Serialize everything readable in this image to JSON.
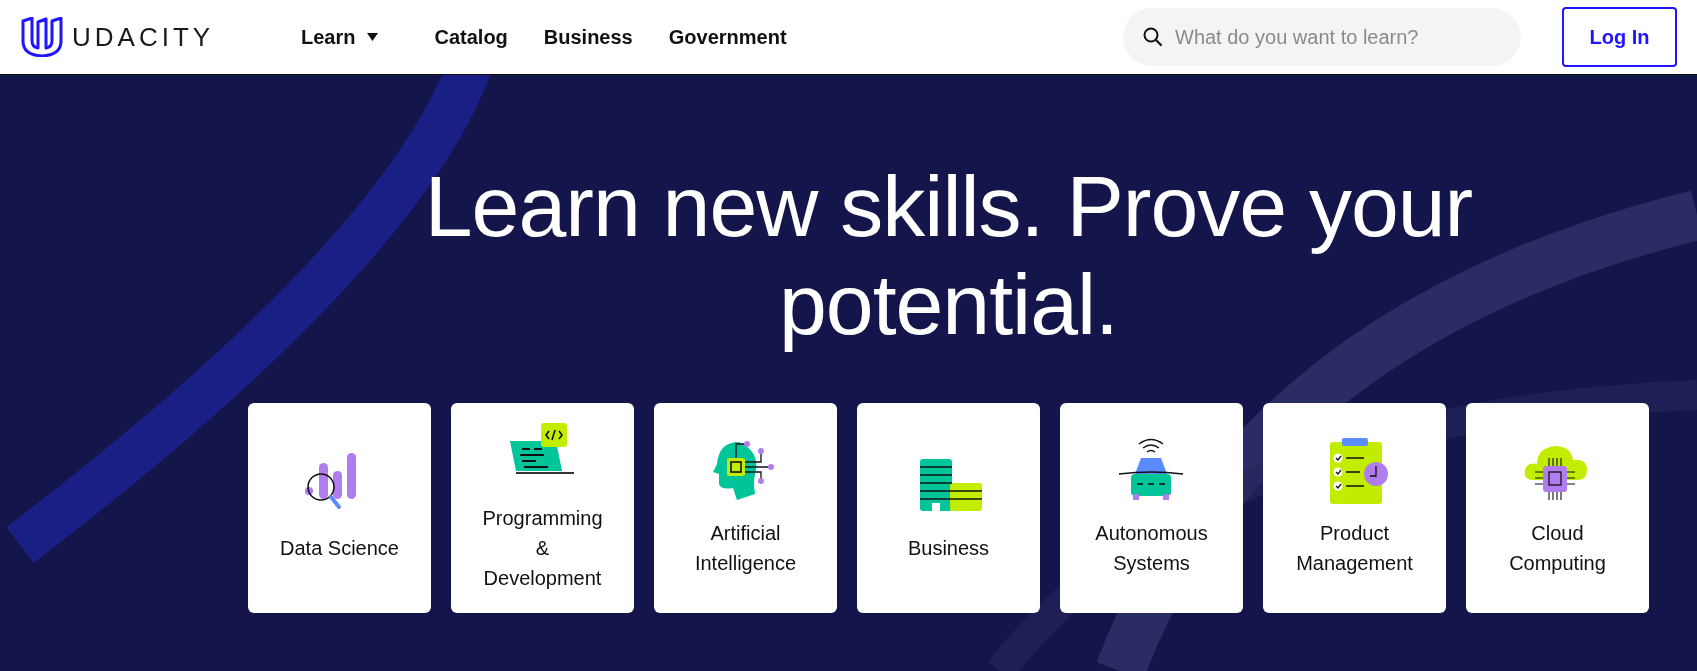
{
  "header": {
    "logo_text": "UDACITY",
    "nav": [
      {
        "label": "Learn",
        "dropdown": true
      },
      {
        "label": "Catalog",
        "dropdown": false
      },
      {
        "label": "Business",
        "dropdown": false
      },
      {
        "label": "Government",
        "dropdown": false
      }
    ],
    "search": {
      "placeholder": "What do you want to learn?"
    },
    "login_button": "Log In"
  },
  "hero": {
    "headline": "Learn new skills. Prove your potential.",
    "categories": [
      {
        "label": "Data Science"
      },
      {
        "label": "Programming & Development"
      },
      {
        "label": "Artificial Intelligence"
      },
      {
        "label": "Business"
      },
      {
        "label": "Autonomous Systems"
      },
      {
        "label": "Product Management"
      },
      {
        "label": "Cloud Computing"
      }
    ]
  }
}
